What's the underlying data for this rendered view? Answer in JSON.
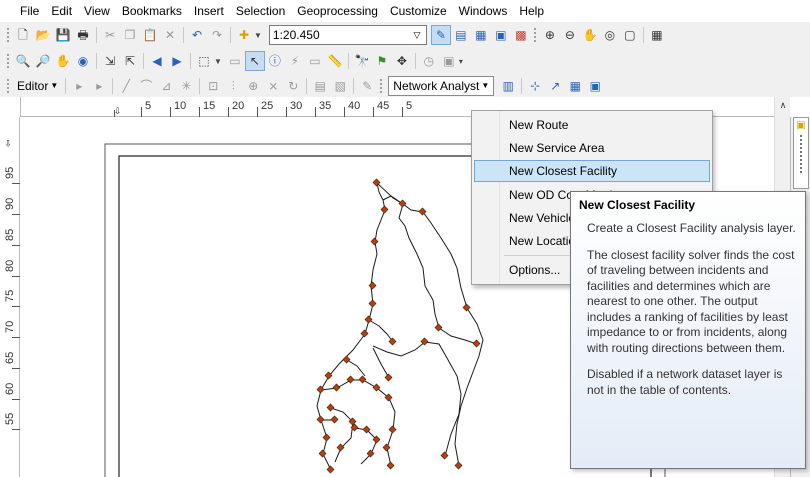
{
  "menu_bar": [
    "File",
    "Edit",
    "View",
    "Bookmarks",
    "Insert",
    "Selection",
    "Geoprocessing",
    "Customize",
    "Windows",
    "Help"
  ],
  "standard_toolbar": {
    "scale_value": "1:20.450"
  },
  "editor_toolbar": {
    "editor_label": "Editor",
    "network_analyst_label": "Network Analyst"
  },
  "ruler": {
    "horizontal": [
      "5",
      "10",
      "15",
      "20",
      "25",
      "30",
      "35",
      "40",
      "45",
      "5"
    ],
    "vertical": [
      "95",
      "90",
      "85",
      "80",
      "75",
      "70",
      "65",
      "60",
      "55"
    ]
  },
  "network_menu": {
    "items": [
      "New Route",
      "New Service Area",
      "New Closest Facility",
      "New OD Cost Matrix",
      "New Vehicle Routing Problem",
      "New Location-Allocation"
    ],
    "options": "Options...",
    "highlighted_index": 2
  },
  "tooltip": {
    "title": "New Closest Facility",
    "p1": "Create a Closest Facility analysis layer.",
    "p2": "The closest facility solver finds the cost of traveling between incidents and facilities and determines which are nearest to one other. The output includes a ranking of facilities by least impedance to or from incidents, along with routing directions between them.",
    "p3": "Disabled if a network dataset layer is not in the table of contents."
  },
  "colors": {
    "node": "#b5400f",
    "menu_highlight": "#cce4f7",
    "menu_highlight_border": "#70a7dc"
  }
}
